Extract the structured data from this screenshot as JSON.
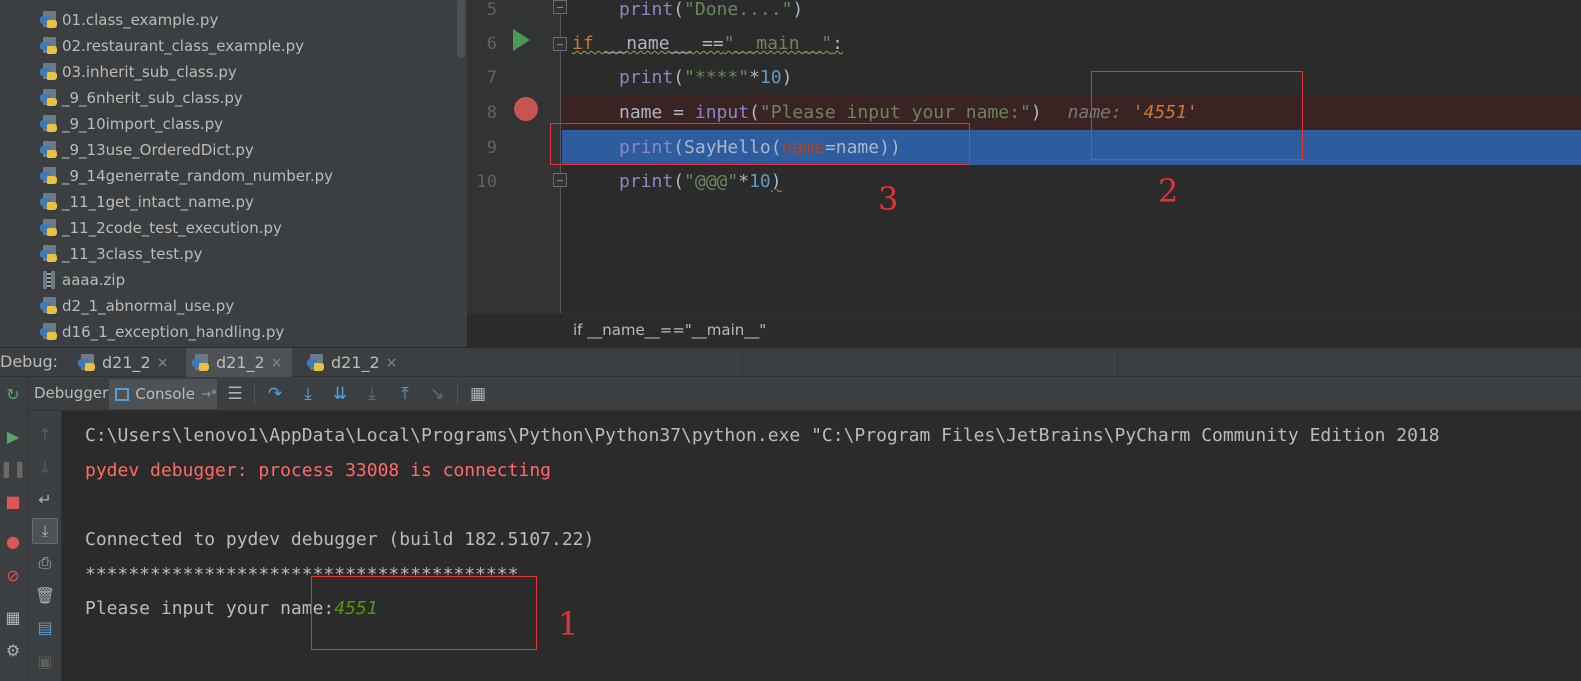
{
  "project_tree": {
    "items": [
      {
        "name": "01.class_example.py",
        "type": "python"
      },
      {
        "name": "02.restaurant_class_example.py",
        "type": "python"
      },
      {
        "name": "03.inherit_sub_class.py",
        "type": "python"
      },
      {
        "name": "_9_6nherit_sub_class.py",
        "type": "python"
      },
      {
        "name": "_9_10import_class.py",
        "type": "python"
      },
      {
        "name": "_9_13use_OrderedDict.py",
        "type": "python"
      },
      {
        "name": "_9_14generrate_random_number.py",
        "type": "python"
      },
      {
        "name": "_11_1get_intact_name.py",
        "type": "python"
      },
      {
        "name": "_11_2code_test_execution.py",
        "type": "python"
      },
      {
        "name": "_11_3class_test.py",
        "type": "python"
      },
      {
        "name": "aaaa.zip",
        "type": "zip"
      },
      {
        "name": "d2_1_abnormal_use.py",
        "type": "python"
      },
      {
        "name": "d16_1_exception_handling.py",
        "type": "python"
      }
    ]
  },
  "editor": {
    "line_numbers": [
      "5",
      "6",
      "7",
      "8",
      "9",
      "10"
    ],
    "lines": {
      "l5": {
        "p1": "print",
        "p2": "(",
        "p3": "\"Done....\"",
        "p4": ")"
      },
      "l6": {
        "p1": "if",
        "p2": " __name__ ==",
        "p3": "\"__main__\"",
        "p4": ":"
      },
      "l7": {
        "p1": "print",
        "p2": "(",
        "p3": "\"****\"",
        "p4": "*",
        "p5": "10",
        "p6": ")"
      },
      "l8": {
        "p1": "name = ",
        "p2": "input",
        "p3": "(",
        "p4": "\"Please input your name:\"",
        "p5": ")",
        "hint_name": "name: ",
        "hint_value": "'4551'"
      },
      "l9": {
        "p1": "print",
        "p2": "(SayHello(",
        "p3": "name",
        "p4": "=name))"
      },
      "l10": {
        "p1": "print",
        "p2": "(",
        "p3": "\"@@@\"",
        "p4": "*",
        "p5": "10",
        "p6": ")"
      }
    },
    "breadcrumb": "if __name__==\"__main__\""
  },
  "debug": {
    "label": "Debug:",
    "tabs": [
      {
        "label": "d21_2",
        "close": "×"
      },
      {
        "label": "d21_2",
        "close": "×"
      },
      {
        "label": "d21_2",
        "close": "×"
      }
    ],
    "toolbar": {
      "debugger_label": "Debugger",
      "console_label": "Console",
      "console_pin": "→*"
    }
  },
  "console": {
    "lines": [
      "C:\\Users\\lenovo1\\AppData\\Local\\Programs\\Python\\Python37\\python.exe \"C:\\Program Files\\JetBrains\\PyCharm Community Edition 2018",
      "pydev debugger: process 33008 is connecting",
      "Connected to pydev debugger (build 182.5107.22)",
      "****************************************",
      "Please input your name:"
    ],
    "input_value": "4551"
  },
  "annotations": {
    "labels": [
      "1",
      "2",
      "3"
    ],
    "color": "#e53333"
  },
  "colors": {
    "keyword": "#cc7832",
    "string": "#6a8759",
    "number": "#6897bb",
    "breakpoint": "#c75450",
    "execution_line": "#2d5d9e",
    "error_text": "#ff6b68"
  }
}
